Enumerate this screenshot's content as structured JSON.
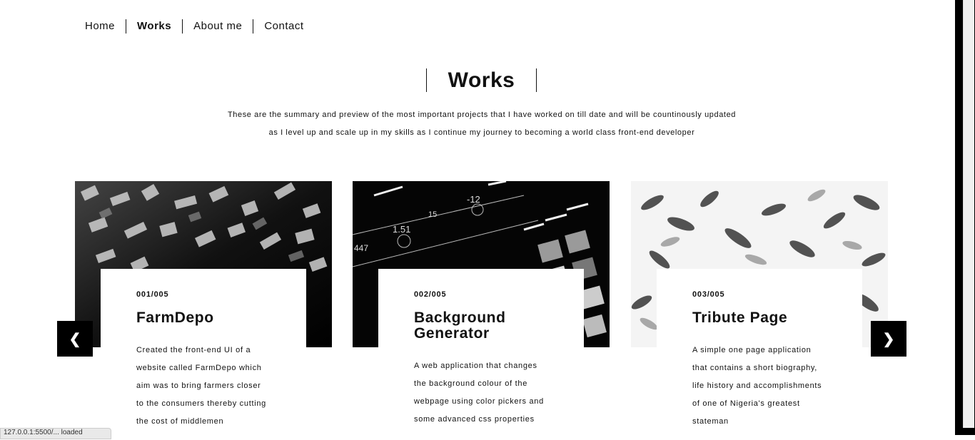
{
  "nav": {
    "items": [
      "Home",
      "Works",
      "About me",
      "Contact"
    ],
    "active": "Works"
  },
  "page": {
    "title": "Works",
    "intro_line1": "These are the summary and preview of the most important projects that I have worked on till date and will be countinously updated",
    "intro_line2": "as I level up and scale up in my skills as I continue my journey to becoming a world class front-end developer"
  },
  "cards": [
    {
      "num": "001/005",
      "title": "FarmDepo",
      "desc": [
        "Created the front-end UI of a",
        "website called FarmDepo which",
        "aim was to bring farmers closer",
        "to the consumers thereby cutting",
        "the cost of middlemen"
      ],
      "image": "typography-letters-photo"
    },
    {
      "num": "002/005",
      "title": "Background Generator",
      "desc": [
        "A web application that changes",
        "the background colour of the",
        "webpage using color pickers and",
        "some advanced css properties"
      ],
      "image": "music-controller-pads-photo"
    },
    {
      "num": "003/005",
      "title": "Tribute Page",
      "desc": [
        "A simple one page application",
        "that contains a short biography,",
        "life history and accomplishments",
        "of one of Nigeria's greatest",
        "stateman"
      ],
      "image": "leaves-pattern-photo"
    }
  ],
  "carousel": {
    "prev_label": "❮",
    "next_label": "❯",
    "prev_icon": "chevron-left-icon",
    "next_icon": "chevron-right-icon"
  },
  "statusbar": {
    "text": "127.0.0.1:5500/... loaded"
  }
}
